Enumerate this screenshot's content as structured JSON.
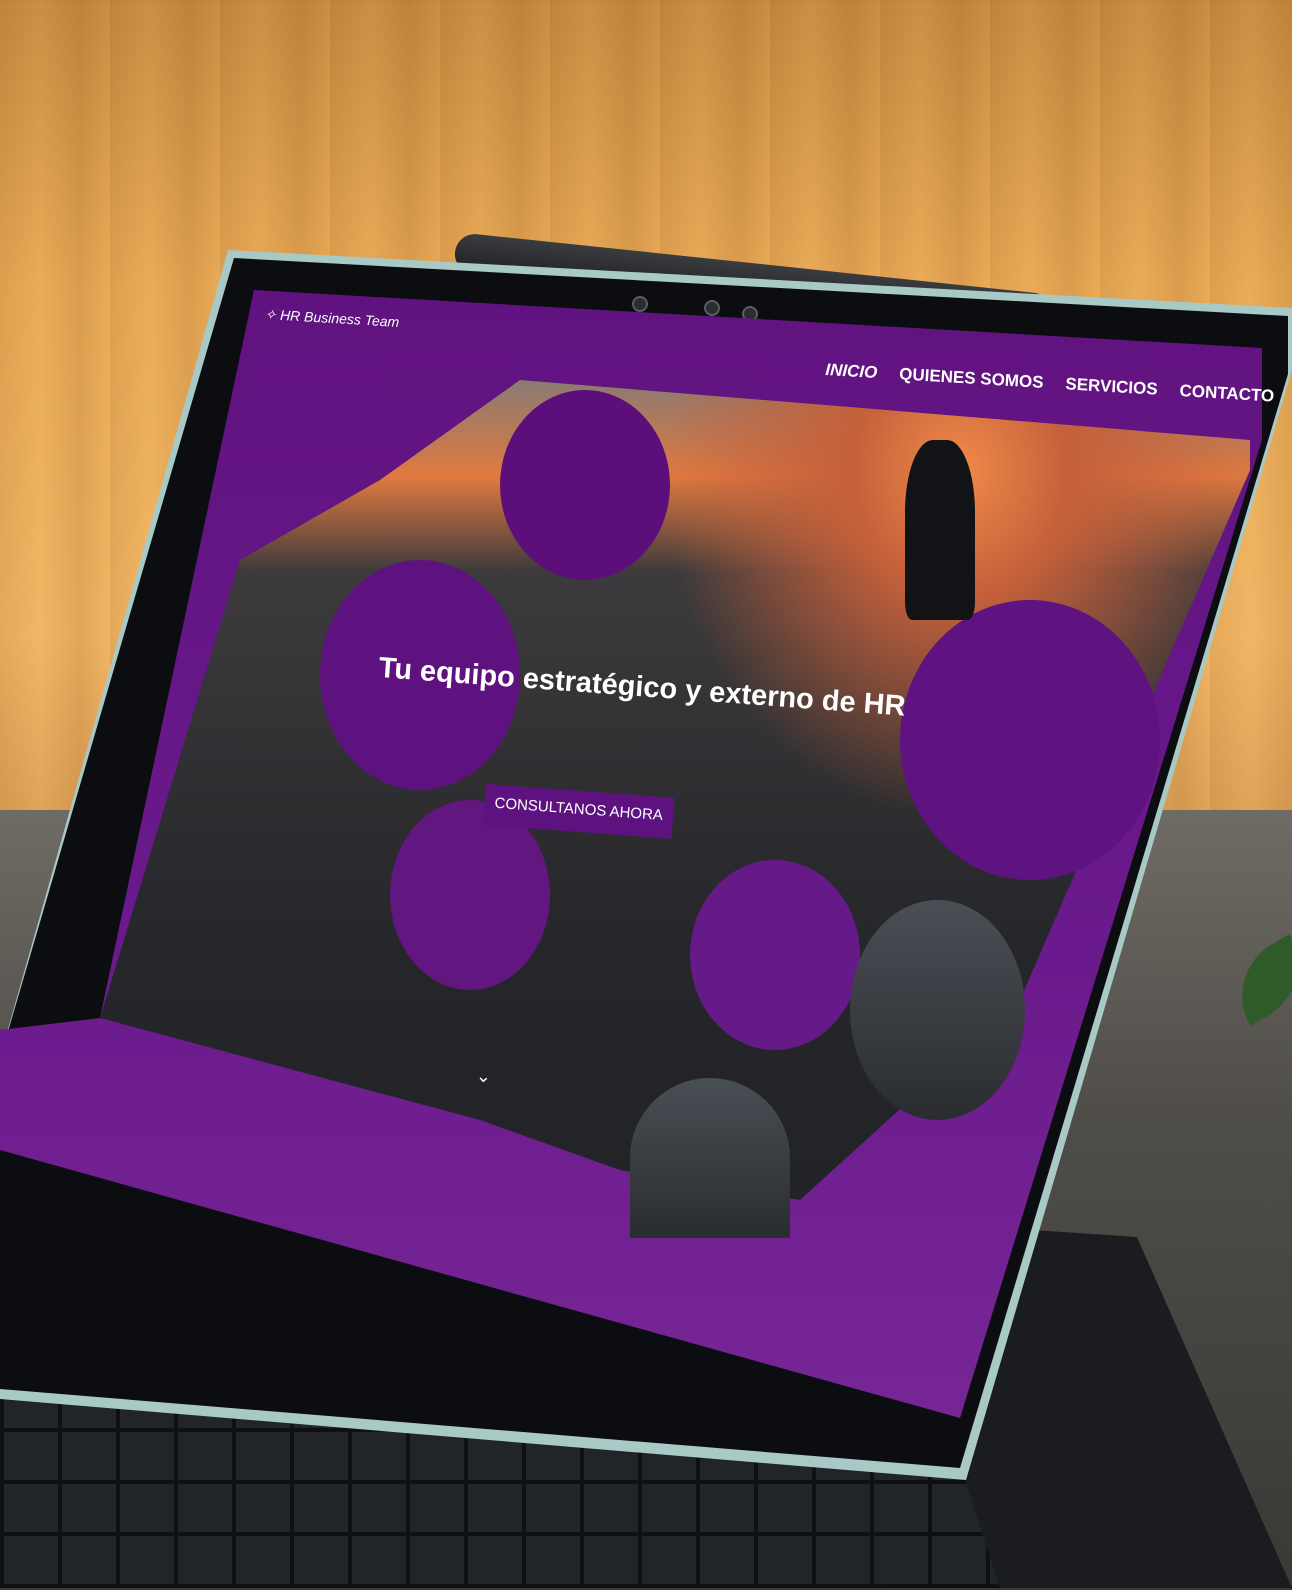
{
  "site": {
    "logo_text": "✧ HR Business Team"
  },
  "nav": {
    "items": [
      "INICIO",
      "QUIENES SOMOS",
      "SERVICIOS",
      "CONTACTO"
    ],
    "active_index": 0
  },
  "hero": {
    "headline": "Tu equipo estratégico y externo de HR",
    "cta_label": "CONSULTANOS AHORA",
    "scroll_icon": "chevron-down-icon"
  },
  "colors": {
    "brand_purple": "#6a1a8c",
    "text": "#ffffff"
  }
}
